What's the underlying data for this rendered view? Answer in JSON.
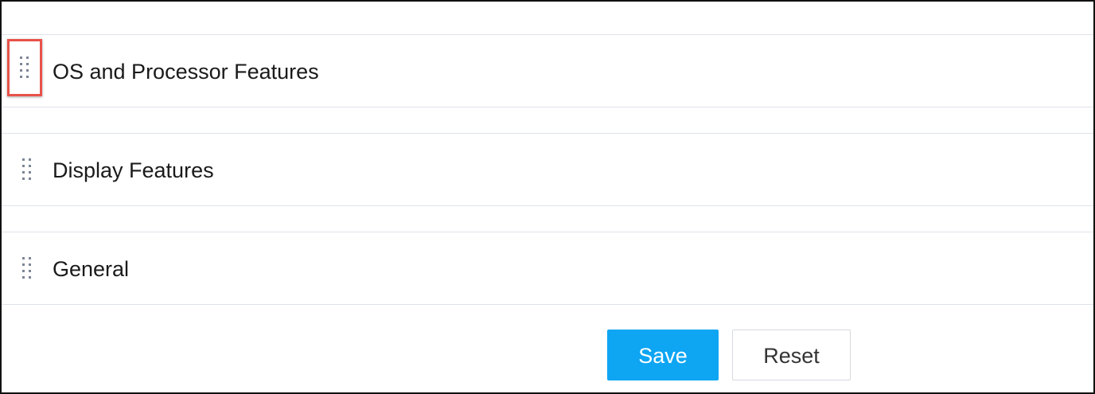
{
  "sections": [
    {
      "label": "OS and Processor Features",
      "handle_icon": "drag-handle-icon",
      "highlighted": true
    },
    {
      "label": "Display Features",
      "handle_icon": "drag-handle-icon",
      "highlighted": false
    },
    {
      "label": "General",
      "handle_icon": "drag-handle-icon",
      "highlighted": false
    }
  ],
  "actions": {
    "save_label": "Save",
    "reset_label": "Reset"
  },
  "colors": {
    "primary": "#0ea5f3",
    "highlight": "#e8524a",
    "divider": "#dfe3ea",
    "handle": "#7c8696"
  }
}
